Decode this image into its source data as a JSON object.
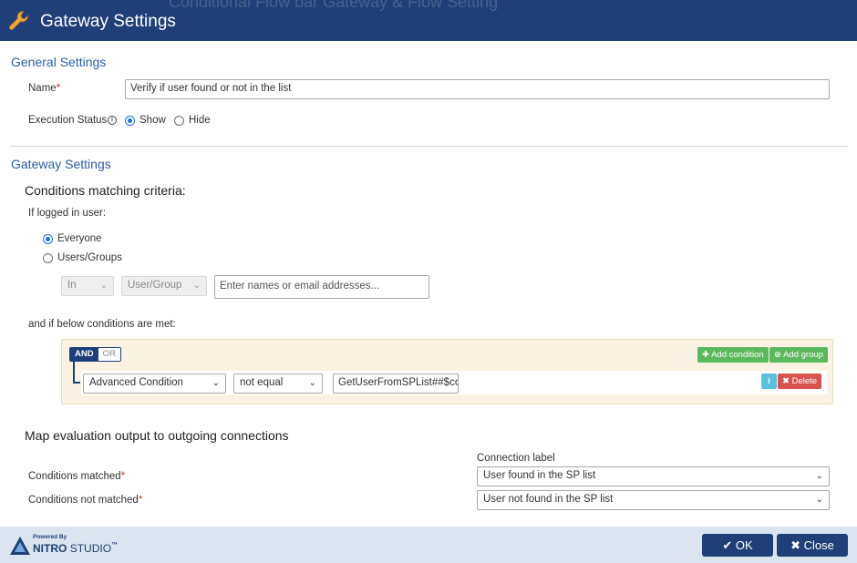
{
  "header": {
    "title": "Gateway Settings",
    "background_text": "Conditional Flow bar Gateway & Flow Setting"
  },
  "general": {
    "section_title": "General Settings",
    "name_label": "Name",
    "name_value": "Verify if user found or not in the list",
    "execution_status_label": "Execution Status",
    "status_options": [
      {
        "label": "Show",
        "selected": true
      },
      {
        "label": "Hide",
        "selected": false
      }
    ]
  },
  "gateway": {
    "section_title": "Gateway Settings",
    "criteria_heading": "Conditions matching criteria:",
    "logged_in_label": "If logged in user:",
    "user_options": [
      {
        "label": "Everyone",
        "selected": true
      },
      {
        "label": "Users/Groups",
        "selected": false
      }
    ],
    "in_select": "In",
    "user_group_select": "User/Group",
    "names_placeholder": "Enter names or email addresses...",
    "conditions_label": "and if below conditions are met:",
    "logic": {
      "and": "AND",
      "or": "OR",
      "selected": "AND"
    },
    "add_condition_label": "Add condition",
    "add_group_label": "Add group",
    "condition": {
      "field": "Advanced Condition",
      "operator": "not equal",
      "value": "GetUserFromSPList##$cou"
    },
    "delete_label": "Delete"
  },
  "mapping": {
    "heading": "Map evaluation output to outgoing connections",
    "connection_label_header": "Connection label",
    "rows": [
      {
        "label": "Conditions matched",
        "value": "User found in the SP list"
      },
      {
        "label": "Conditions not matched",
        "value": "User not found in the SP list"
      }
    ]
  },
  "footer": {
    "powered_by": "Powered By",
    "brand_bold": "NITRO",
    "brand_light": "STUDIO",
    "trademark": "™",
    "ok_label": "OK",
    "close_label": "Close"
  },
  "colors": {
    "header_bg": "#1e3f77",
    "section_title": "#2a5fa8",
    "required": "#c0392b",
    "add_button": "#5cb85c",
    "delete_button": "#d9534f",
    "info_button": "#5bc0de",
    "footer_bg": "#dce5ef"
  },
  "icons": {
    "title": "wrench-icon",
    "info": "info-icon",
    "add_condition": "plus-icon",
    "add_group": "plus-circle-icon",
    "delete": "times-icon",
    "ok": "check-icon",
    "close": "times-icon",
    "dropdown": "chevron-down-icon"
  }
}
